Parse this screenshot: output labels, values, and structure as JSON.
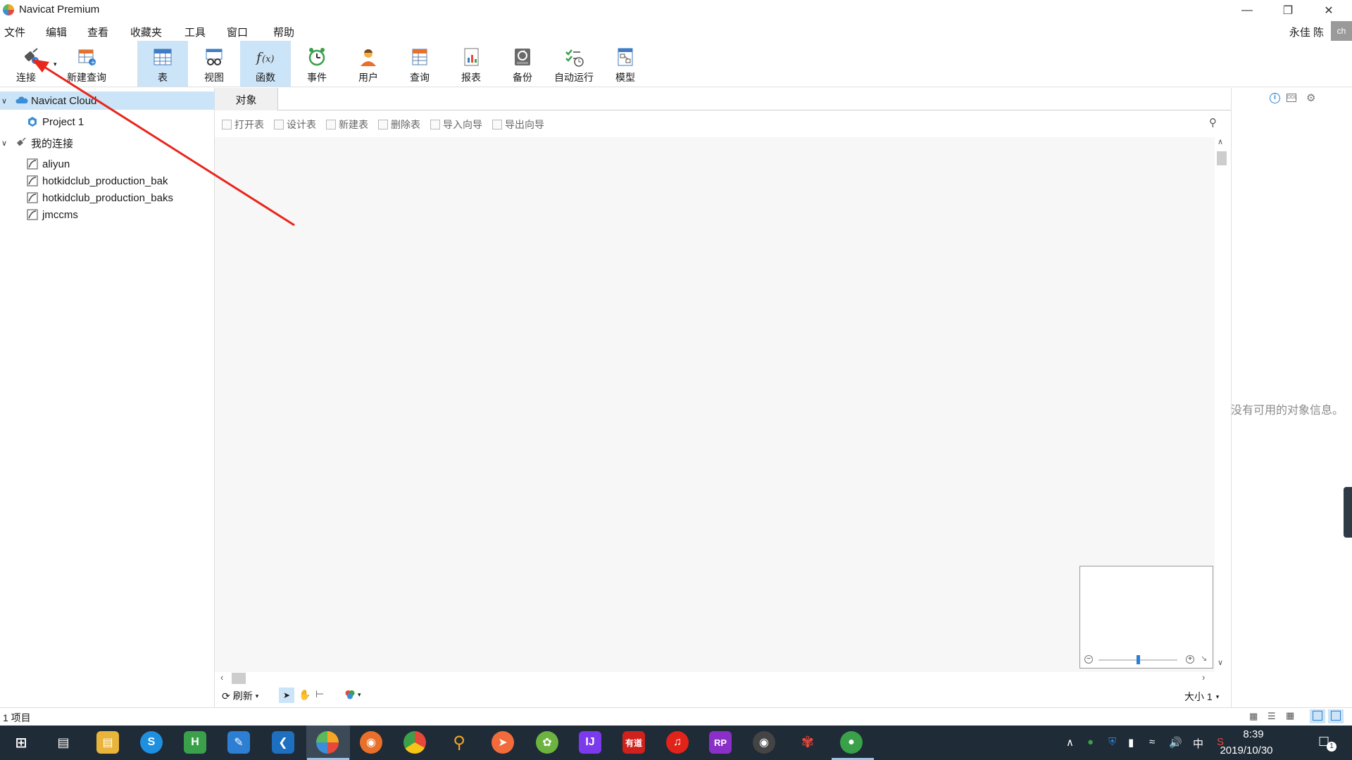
{
  "window": {
    "title": "Navicat Premium"
  },
  "menu": [
    "文件",
    "编辑",
    "查看",
    "收藏夹",
    "工具",
    "窗口",
    "帮助"
  ],
  "user": {
    "name": "永佳 陈",
    "avatar": "ch"
  },
  "toolbar": {
    "connect": "连接",
    "new_query": "新建查询",
    "table": "表",
    "view": "视图",
    "function": "函数",
    "event": "事件",
    "user": "用户",
    "query": "查询",
    "report": "报表",
    "backup": "备份",
    "automation": "自动运行",
    "model": "模型"
  },
  "tree": {
    "cloud": {
      "label": "Navicat Cloud",
      "project": "Project 1"
    },
    "my_connections": {
      "label": "我的连接",
      "items": [
        "aliyun",
        "hotkidclub_production_bak",
        "hotkidclub_production_baks",
        "jmccms"
      ]
    }
  },
  "tabs": {
    "objects": "对象"
  },
  "object_actions": [
    "打开表",
    "设计表",
    "新建表",
    "删除表",
    "导入向导",
    "导出向导"
  ],
  "bottom": {
    "refresh": "刷新",
    "size": "大小 1"
  },
  "info_panel": {
    "empty_text": "没有可用的对象信息。"
  },
  "status": {
    "count": "1 项目"
  },
  "taskbar": {
    "time": "8:39",
    "date": "2019/10/30",
    "ime": "中",
    "notifications": "1"
  },
  "colors": {
    "selection": "#cce4f7",
    "arrow": "#e8261c",
    "taskbar": "#1f2b36"
  }
}
